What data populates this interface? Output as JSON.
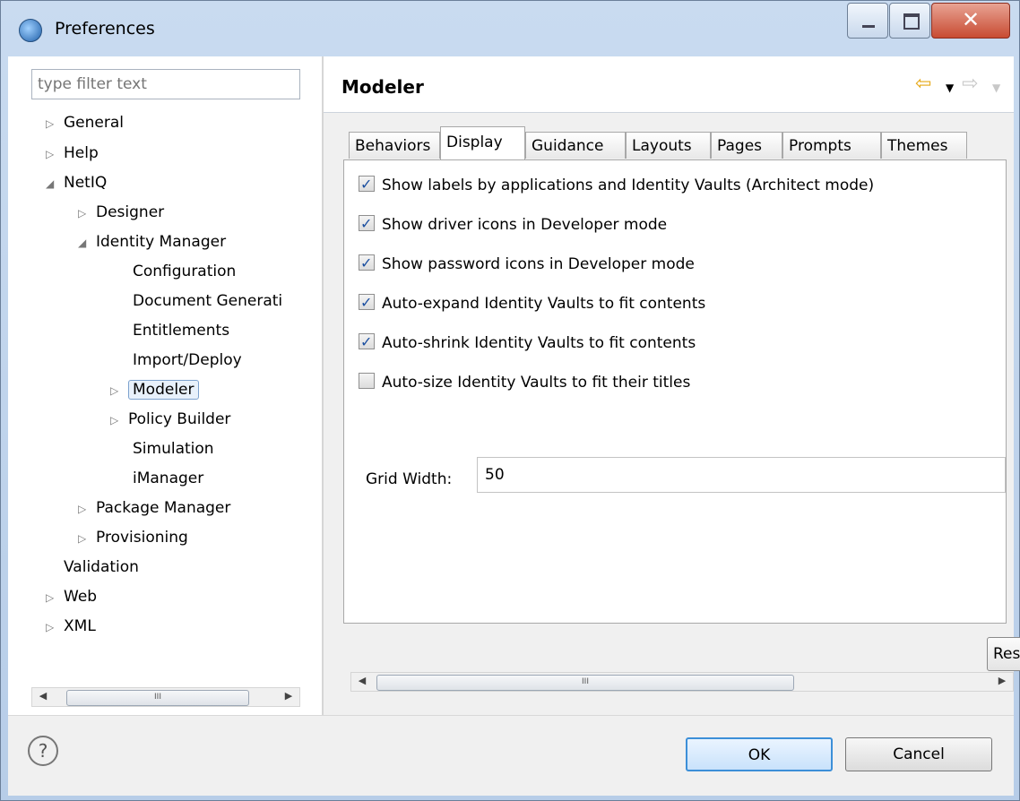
{
  "window": {
    "title": "Preferences"
  },
  "filter": {
    "placeholder": "type filter text"
  },
  "tree": {
    "general": "General",
    "help": "Help",
    "netiq": "NetIQ",
    "designer": "Designer",
    "identity_manager": "Identity Manager",
    "configuration": "Configuration",
    "document_generation": "Document Generati",
    "entitlements": "Entitlements",
    "import_deploy": "Import/Deploy",
    "modeler": "Modeler",
    "policy_builder": "Policy Builder",
    "simulation": "Simulation",
    "imanager": "iManager",
    "package_manager": "Package Manager",
    "provisioning": "Provisioning",
    "validation": "Validation",
    "web": "Web",
    "xml": "XML"
  },
  "page": {
    "title": "Modeler"
  },
  "tabs": [
    "Behaviors",
    "Display",
    "Guidance",
    "Layouts",
    "Pages",
    "Prompts",
    "Themes"
  ],
  "active_tab": "Display",
  "options": [
    {
      "label": "Show labels by applications and Identity Vaults (Architect mode)",
      "checked": true
    },
    {
      "label": "Show driver icons in Developer mode",
      "checked": true
    },
    {
      "label": "Show password icons in Developer mode",
      "checked": true
    },
    {
      "label": "Auto-expand Identity Vaults to fit contents",
      "checked": true
    },
    {
      "label": "Auto-shrink Identity Vaults to fit contents",
      "checked": true
    },
    {
      "label": "Auto-size Identity Vaults to fit their titles",
      "checked": false
    }
  ],
  "grid_width": {
    "label": "Grid Width:",
    "value": "50"
  },
  "restore_label": "Restore Defaults",
  "buttons": {
    "ok": "OK",
    "cancel": "Cancel"
  },
  "colors": {
    "accent": "#3c8fd8",
    "check": "#1b4fa0"
  }
}
